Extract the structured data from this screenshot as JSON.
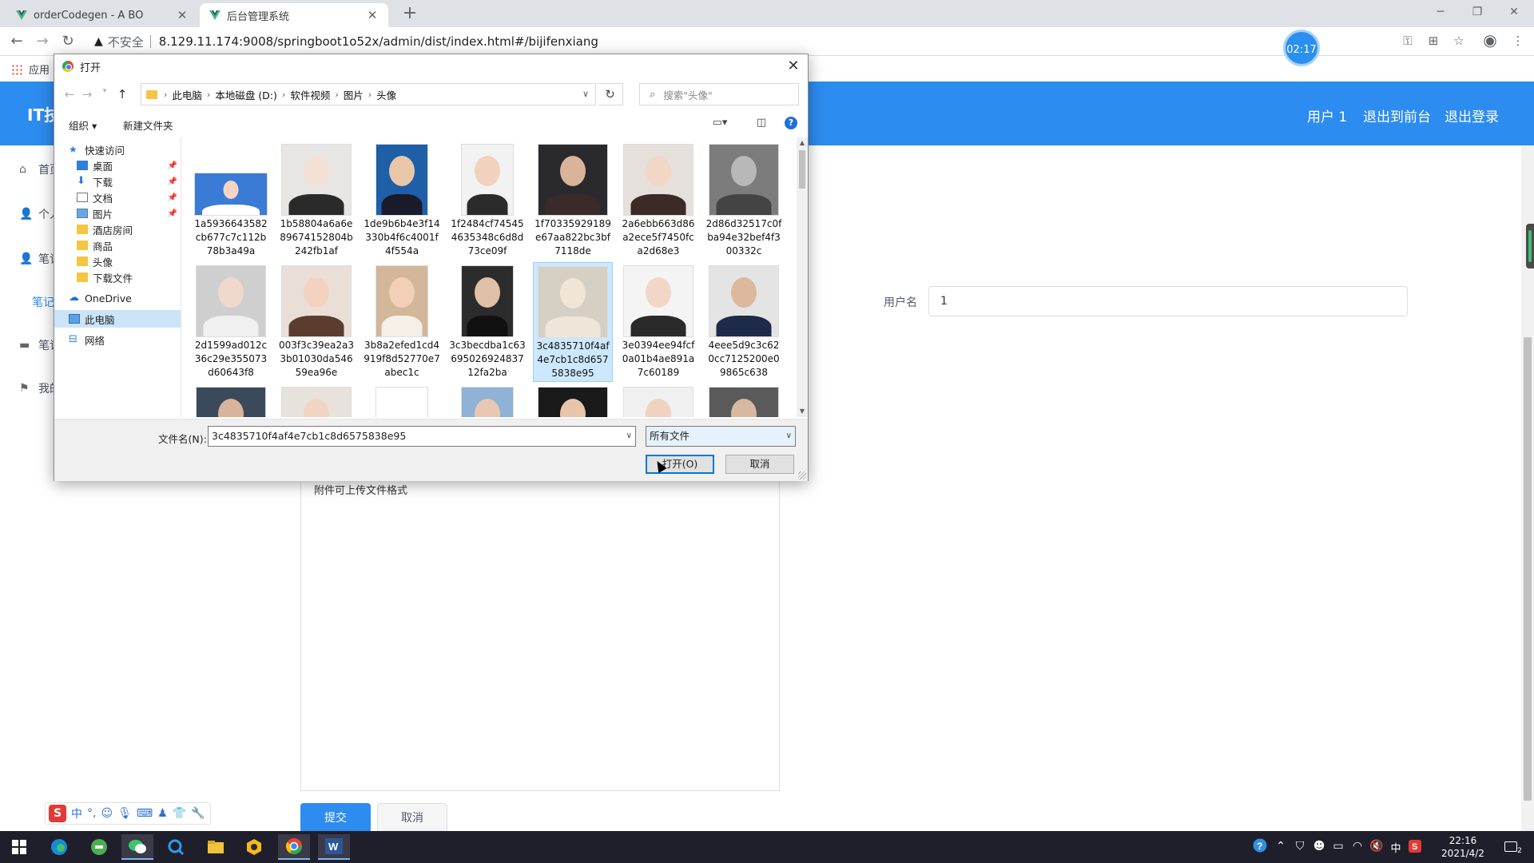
{
  "browser": {
    "tabs": [
      {
        "title": "orderCodegen - A BO",
        "active": false
      },
      {
        "title": "后台管理系统",
        "active": true
      }
    ],
    "insecure_label": "不安全",
    "url": "8.129.11.174:9008/springboot1o52x/admin/dist/index.html#/bijifenxiang",
    "timer": "02:17",
    "bookmarks_apps": "应用"
  },
  "app": {
    "logo": "IT技",
    "header_links": [
      "用户 1",
      "退出到前台",
      "退出登录"
    ],
    "sidebar": [
      {
        "label": "首页",
        "icon": "home-icon"
      },
      {
        "label": "个人",
        "icon": "user-icon"
      },
      {
        "label": "笔记",
        "icon": "user-group-icon"
      },
      {
        "label": "笔记",
        "icon": ""
      },
      {
        "label": "笔记",
        "icon": "monitor-icon"
      },
      {
        "label": "我的",
        "icon": "flag-icon"
      }
    ],
    "username_label": "用户名",
    "username_value": "1",
    "editor_hint": "附件可上传文件格式",
    "submit_label": "提交",
    "cancel_label": "取消"
  },
  "dialog": {
    "title": "打开",
    "breadcrumbs": [
      "此电脑",
      "本地磁盘 (D:)",
      "软件视频",
      "图片",
      "头像"
    ],
    "search_placeholder": "搜索\"头像\"",
    "organize_label": "组织 ▾",
    "new_folder_label": "新建文件夹",
    "tree": [
      {
        "label": "快速访问",
        "indent": 0,
        "icon": "star-icon",
        "pinned": false
      },
      {
        "label": "桌面",
        "indent": 1,
        "icon": "desktop-icon",
        "pinned": true
      },
      {
        "label": "下载",
        "indent": 1,
        "icon": "download-icon",
        "pinned": true
      },
      {
        "label": "文档",
        "indent": 1,
        "icon": "document-icon",
        "pinned": true
      },
      {
        "label": "图片",
        "indent": 1,
        "icon": "pictures-icon",
        "pinned": true
      },
      {
        "label": "酒店房间",
        "indent": 1,
        "icon": "folder-icon",
        "pinned": false
      },
      {
        "label": "商品",
        "indent": 1,
        "icon": "folder-icon",
        "pinned": false
      },
      {
        "label": "头像",
        "indent": 1,
        "icon": "folder-icon",
        "pinned": false
      },
      {
        "label": "下载文件",
        "indent": 1,
        "icon": "folder-icon",
        "pinned": false
      },
      {
        "label": "OneDrive",
        "indent": 0,
        "icon": "cloud-icon",
        "pinned": false
      },
      {
        "label": "此电脑",
        "indent": 0,
        "icon": "computer-icon",
        "pinned": false,
        "selected": true
      },
      {
        "label": "网络",
        "indent": 0,
        "icon": "network-icon",
        "pinned": false
      }
    ],
    "files": [
      {
        "name": "1a5936643582cb677c7c112b78b3a49a",
        "bg": "#3a7bd5",
        "skin": "#f6d5c4",
        "cloth": "#ffffff",
        "wide": true
      },
      {
        "name": "1b58804a6a6e89674152804b242fb1af",
        "bg": "#e8e6e4",
        "skin": "#f4e1d6",
        "cloth": "#2a2a2a",
        "wide": false
      },
      {
        "name": "1de9b6b4e3f14330b4f6c4001f4f554a",
        "bg": "#1e5fa8",
        "skin": "#e9c6a8",
        "cloth": "#1a1a2a",
        "wide": false
      },
      {
        "name": "1f2484cf745454635348c6d8d73ce09f",
        "bg": "#f2f2f2",
        "skin": "#f0d2be",
        "cloth": "#2b2b2b",
        "wide": false
      },
      {
        "name": "1f70335929189e67aa822bc3bf7118de",
        "bg": "#2a2a2e",
        "skin": "#d9b39a",
        "cloth": "#3a2a2a",
        "wide": false
      },
      {
        "name": "2a6ebb663d86a2ece5f7450fca2d68e3",
        "bg": "#e6e0dc",
        "skin": "#f2d6c6",
        "cloth": "#3b2a26",
        "wide": false
      },
      {
        "name": "2d86d32517c0fba94e32bef4f300332c",
        "bg": "#7c7c7c",
        "skin": "#b8b8b8",
        "cloth": "#444444",
        "wide": false
      },
      {
        "name": "2d1599ad012c36c29e355073d60643f8",
        "bg": "#cfcfcf",
        "skin": "#efd9cf",
        "cloth": "#f0f0f0",
        "wide": false
      },
      {
        "name": "003f3c39ea2a33b01030da54659ea96e",
        "bg": "#e9dfd6",
        "skin": "#f3d3c0",
        "cloth": "#5b3d30",
        "wide": false
      },
      {
        "name": "3b8a2efed1cd4919f8d52770e7abec1c",
        "bg": "#d2b79b",
        "skin": "#f2d0b8",
        "cloth": "#f6efe8",
        "wide": false
      },
      {
        "name": "3c3becdba1c6369502692483712fa2ba",
        "bg": "#2c2c2c",
        "skin": "#e0c0a6",
        "cloth": "#111111",
        "wide": false
      },
      {
        "name": "3c4835710f4af4e7cb1c8d6575838e95",
        "bg": "#d6cfc4",
        "skin": "#f1e6d6",
        "cloth": "#efe6da",
        "wide": false,
        "selected": true
      },
      {
        "name": "3e0394ee94fcf0a01b4ae891a7c60189",
        "bg": "#f4f4f4",
        "skin": "#f2d6c6",
        "cloth": "#2a2a2a",
        "wide": false
      },
      {
        "name": "4eee5d9c3c620cc7125200e09865c638",
        "bg": "#e4e4e4",
        "skin": "#dcb89e",
        "cloth": "#1d2a4a",
        "wide": false
      },
      {
        "name": "",
        "bg": "#3a4a5a",
        "skin": "#d8b49a",
        "cloth": "#222222",
        "wide": false
      },
      {
        "name": "",
        "bg": "#e8e2dc",
        "skin": "#f2d4c2",
        "cloth": "#2a2220",
        "wide": false
      },
      {
        "name": "",
        "bg": "#ffffff",
        "skin": "#ffffff",
        "cloth": "#222222",
        "wide": false
      },
      {
        "name": "",
        "bg": "#8fb2d6",
        "skin": "#e8c8b0",
        "cloth": "#556677",
        "wide": false
      },
      {
        "name": "",
        "bg": "#1a1a1a",
        "skin": "#e8c4aa",
        "cloth": "#aa3344",
        "wide": false
      },
      {
        "name": "",
        "bg": "#f0f0f0",
        "skin": "#efd2c0",
        "cloth": "#333333",
        "wide": false
      },
      {
        "name": "",
        "bg": "#5a5a5a",
        "skin": "#d8b8a0",
        "cloth": "#2a2a2a",
        "wide": false
      }
    ],
    "filename_label": "文件名(N):",
    "filename_value": "3c4835710f4af4e7cb1c8d6575838e95",
    "filetype_value": "所有文件",
    "open_label": "打开(O)",
    "cancel_label": "取消"
  },
  "taskbar": {
    "time": "22:16",
    "date": "2021/4/2",
    "ime_mode": "中",
    "notification_count": "2"
  },
  "colors": {
    "primary": "#2d8cf0",
    "selection": "#cce8ff"
  }
}
